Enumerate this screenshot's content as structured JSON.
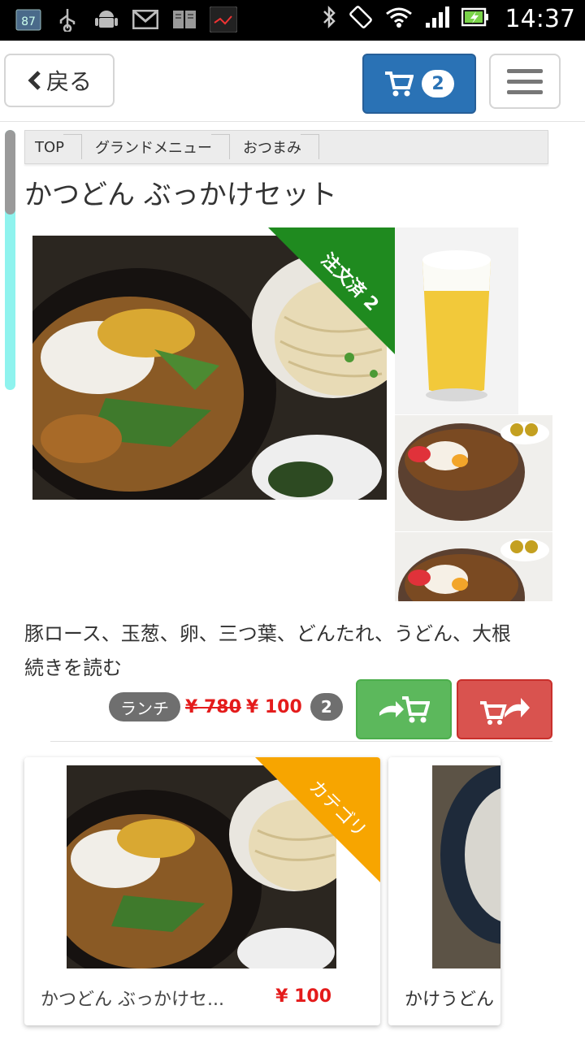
{
  "status_bar": {
    "notification_count": "87",
    "time": "14:37",
    "icons": [
      "calendar-icon",
      "usb-icon",
      "android-icon",
      "gmail-icon",
      "book-icon",
      "app-icon",
      "bluetooth-icon",
      "rotate-icon",
      "wifi-icon",
      "signal-icon",
      "battery-icon"
    ]
  },
  "header": {
    "back_label": "戻る",
    "cart_count": "2",
    "colors": {
      "cart_blue": "#2a72b5"
    }
  },
  "breadcrumb": [
    "TOP",
    "グランドメニュー",
    "おつまみ"
  ],
  "product": {
    "title": "かつどん ぶっかけセット",
    "ordered_ribbon": "注文済 2",
    "description": "豚ロース、玉葱、卵、三つ葉、どんたれ、うどん、大根",
    "read_more": "続きを読む",
    "tag": "ランチ",
    "old_price": "¥ 780",
    "price": "¥ 100",
    "ordered_qty": "2"
  },
  "related": [
    {
      "ribbon": "カテゴリ",
      "name": "かつどん ぶっかけセ...",
      "price": "¥ 100"
    },
    {
      "name": "かけうどん"
    }
  ],
  "colors": {
    "add_button": "#5cb85c",
    "remove_button": "#d9534f",
    "price_red": "#e41b1b",
    "ordered_ribbon": "#1f8a1f",
    "category_ribbon": "#f7a500"
  }
}
